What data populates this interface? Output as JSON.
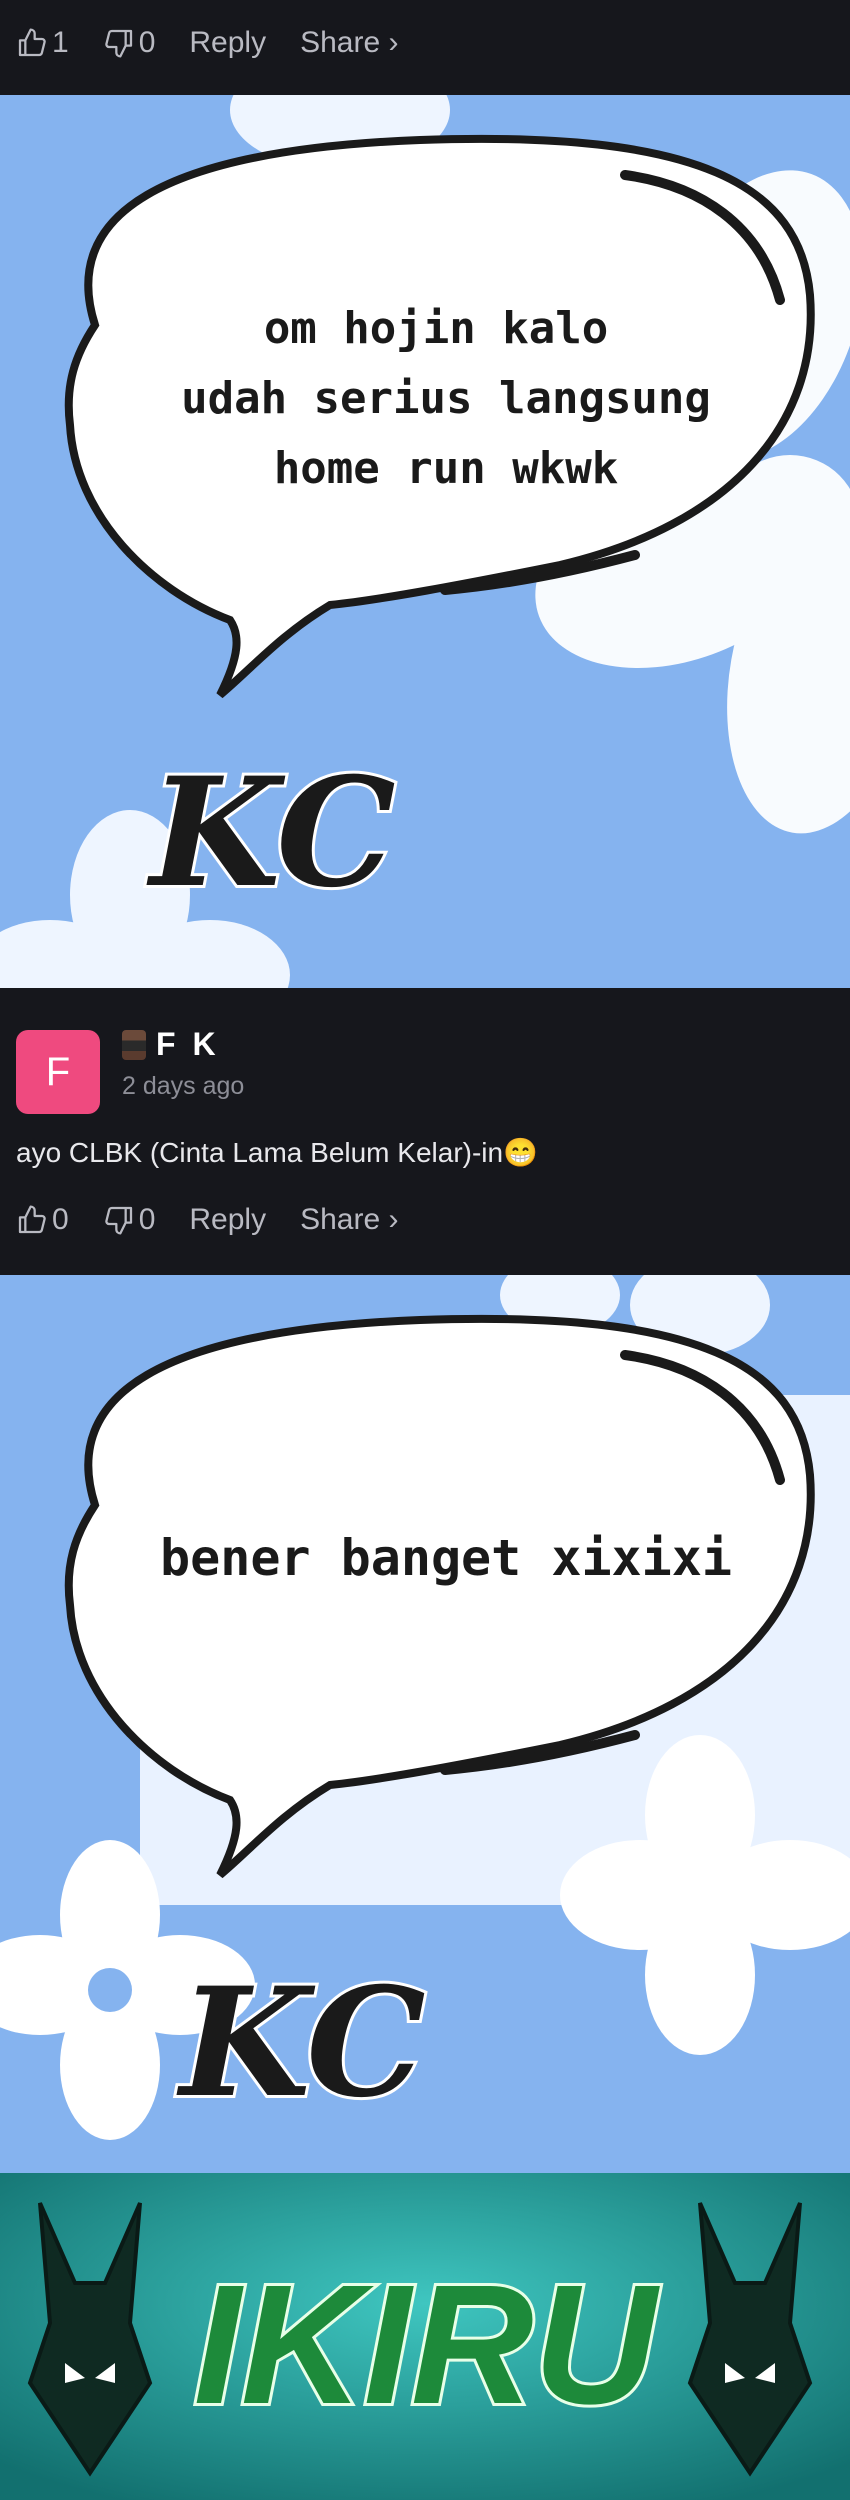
{
  "top_actions": {
    "like_count": "1",
    "dislike_count": "0",
    "reply_label": "Reply",
    "share_label": "Share ›"
  },
  "sticker1": {
    "lines": [
      "om hojin kalo",
      "udah serius langsung",
      "home run wkwk"
    ],
    "logo": "KC"
  },
  "comment": {
    "avatar_letter": "F",
    "username": "F K",
    "time": "2 days ago",
    "body": "ayo CLBK (Cinta Lama Belum Kelar)-in😁",
    "like_count": "0",
    "dislike_count": "0",
    "reply_label": "Reply",
    "share_label": "Share ›"
  },
  "sticker2": {
    "lines": [
      "bener banget xixixi"
    ],
    "logo": "KC"
  },
  "banner": {
    "text": "IKIRU"
  },
  "colors": {
    "background": "#16171c",
    "sticker_bg": "#85b3ef",
    "avatar": "#ef4a7f",
    "banner": "#1f9c99"
  }
}
